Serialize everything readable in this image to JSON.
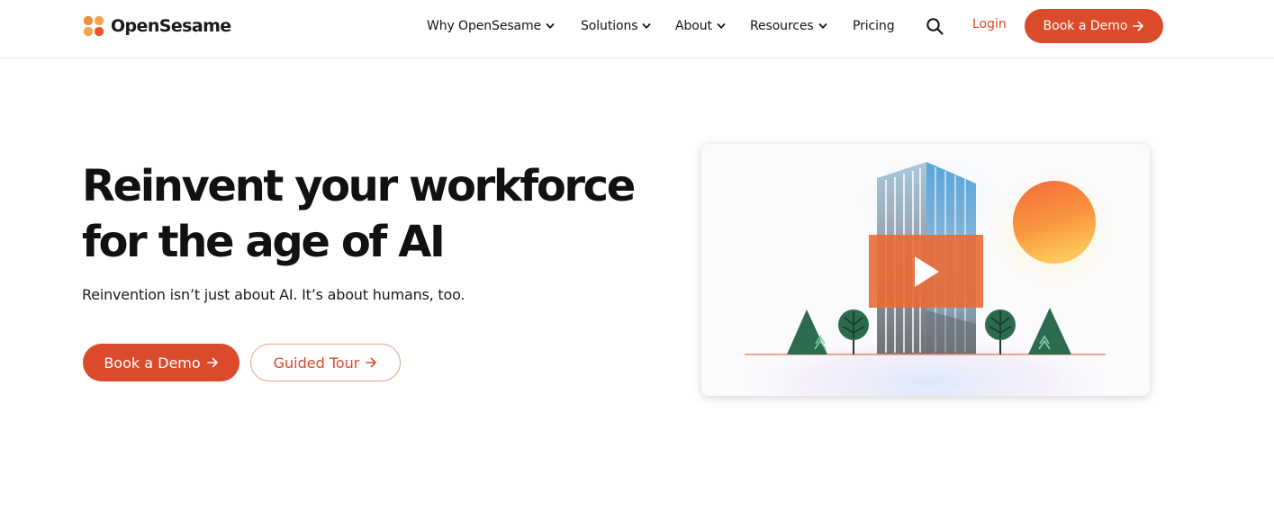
{
  "brand": {
    "name": "OpenSesame",
    "accent": "#db4a2b"
  },
  "nav": {
    "items": [
      {
        "label": "Why OpenSesame",
        "has_dropdown": true
      },
      {
        "label": "Solutions",
        "has_dropdown": true
      },
      {
        "label": "About",
        "has_dropdown": true
      },
      {
        "label": "Resources",
        "has_dropdown": true
      },
      {
        "label": "Pricing",
        "has_dropdown": false
      }
    ],
    "search_icon": "search-icon",
    "login_label": "Login",
    "cta_label": "Book a Demo"
  },
  "hero": {
    "title_line1": "Reinvent your workforce",
    "title_line2": "for the age of AI",
    "subtitle": "Reinvention isn’t just about AI. It’s about humans, too.",
    "primary_cta": "Book a Demo",
    "secondary_cta": "Guided Tour"
  },
  "video": {
    "play_icon": "play-icon"
  }
}
